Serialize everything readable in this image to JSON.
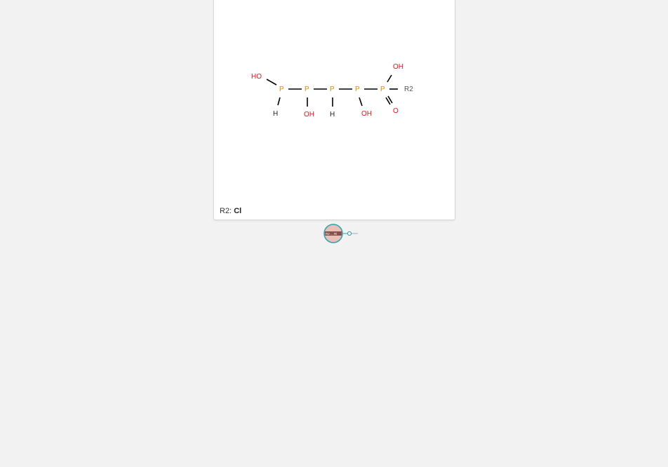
{
  "molecule": {
    "atoms": {
      "p1": "P",
      "p2": "P",
      "p3": "P",
      "p4": "P",
      "p5": "P",
      "ho_left": "HO",
      "h_p1": "H",
      "oh_p2": "OH",
      "h_p3": "H",
      "oh_p4": "OH",
      "oh_p5": "OH",
      "o_p5": "O",
      "r2_label": "R2"
    }
  },
  "footer": {
    "rgroup_name": "R2:",
    "rgroup_value": "Cl"
  },
  "thumbnail": {
    "label": "R2 ... Ri"
  },
  "colors": {
    "phosphorus": "#e8850c",
    "oxygen": "#e8121c",
    "hydrogen": "#222222",
    "rgroup": "#555555",
    "bond": "#000000",
    "thumb_ring": "#2aa4a8"
  }
}
